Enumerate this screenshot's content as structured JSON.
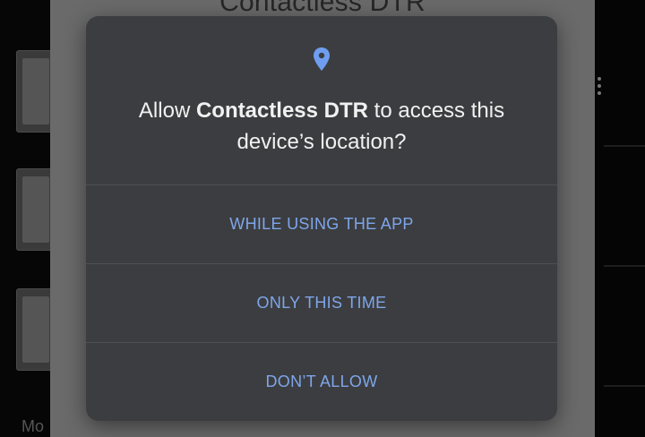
{
  "background_app": {
    "title": "Contactless DTR",
    "edge_text": "Mo"
  },
  "dialog": {
    "icon": "location-pin-icon",
    "message_prefix": "Allow ",
    "app_name": "Contactless DTR",
    "message_suffix": " to access this device’s location?",
    "options": [
      {
        "label": "WHILE USING THE APP"
      },
      {
        "label": "ONLY THIS TIME"
      },
      {
        "label": "DON’T ALLOW"
      }
    ]
  },
  "colors": {
    "dialog_background": "#3c3d40",
    "accent": "#7ea6ea",
    "text": "#f1f1f1"
  }
}
